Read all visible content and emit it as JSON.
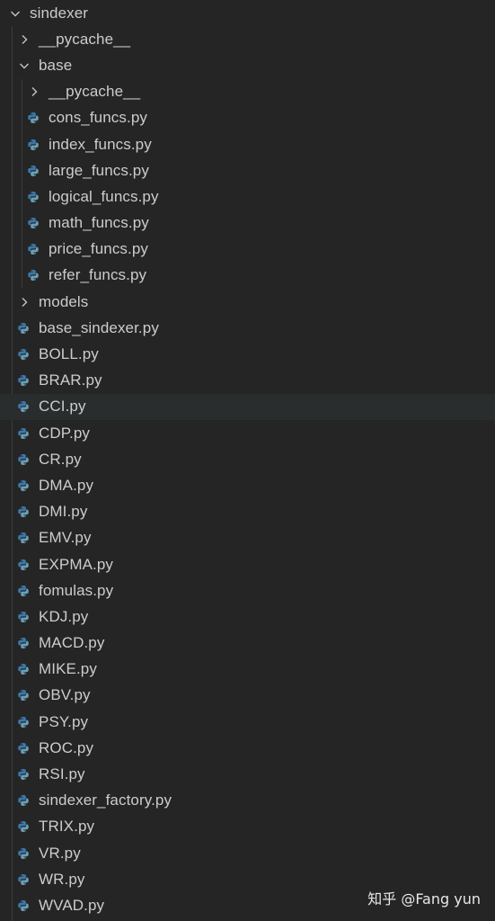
{
  "explorer": {
    "root": {
      "label": "sindexer",
      "expanded": true
    },
    "items": [
      {
        "label": "__pycache__",
        "type": "folder",
        "expanded": false,
        "depth": 1
      },
      {
        "label": "base",
        "type": "folder",
        "expanded": true,
        "depth": 1
      },
      {
        "label": "__pycache__",
        "type": "folder",
        "expanded": false,
        "depth": 2
      },
      {
        "label": "cons_funcs.py",
        "type": "python",
        "depth": 2
      },
      {
        "label": "index_funcs.py",
        "type": "python",
        "depth": 2
      },
      {
        "label": "large_funcs.py",
        "type": "python",
        "depth": 2
      },
      {
        "label": "logical_funcs.py",
        "type": "python",
        "depth": 2
      },
      {
        "label": "math_funcs.py",
        "type": "python",
        "depth": 2
      },
      {
        "label": "price_funcs.py",
        "type": "python",
        "depth": 2
      },
      {
        "label": "refer_funcs.py",
        "type": "python",
        "depth": 2
      },
      {
        "label": "models",
        "type": "folder",
        "expanded": false,
        "depth": 1
      },
      {
        "label": "base_sindexer.py",
        "type": "python",
        "depth": 1
      },
      {
        "label": "BOLL.py",
        "type": "python",
        "depth": 1
      },
      {
        "label": "BRAR.py",
        "type": "python",
        "depth": 1
      },
      {
        "label": "CCI.py",
        "type": "python",
        "depth": 1,
        "selected": true
      },
      {
        "label": "CDP.py",
        "type": "python",
        "depth": 1
      },
      {
        "label": "CR.py",
        "type": "python",
        "depth": 1
      },
      {
        "label": "DMA.py",
        "type": "python",
        "depth": 1
      },
      {
        "label": "DMI.py",
        "type": "python",
        "depth": 1
      },
      {
        "label": "EMV.py",
        "type": "python",
        "depth": 1
      },
      {
        "label": "EXPMA.py",
        "type": "python",
        "depth": 1
      },
      {
        "label": "fomulas.py",
        "type": "python",
        "depth": 1
      },
      {
        "label": "KDJ.py",
        "type": "python",
        "depth": 1
      },
      {
        "label": "MACD.py",
        "type": "python",
        "depth": 1
      },
      {
        "label": "MIKE.py",
        "type": "python",
        "depth": 1
      },
      {
        "label": "OBV.py",
        "type": "python",
        "depth": 1
      },
      {
        "label": "PSY.py",
        "type": "python",
        "depth": 1
      },
      {
        "label": "ROC.py",
        "type": "python",
        "depth": 1
      },
      {
        "label": "RSI.py",
        "type": "python",
        "depth": 1
      },
      {
        "label": "sindexer_factory.py",
        "type": "python",
        "depth": 1
      },
      {
        "label": "TRIX.py",
        "type": "python",
        "depth": 1
      },
      {
        "label": "VR.py",
        "type": "python",
        "depth": 1
      },
      {
        "label": "WR.py",
        "type": "python",
        "depth": 1
      },
      {
        "label": "WVAD.py",
        "type": "python",
        "depth": 1
      }
    ]
  },
  "watermark": "知乎 @Fang yun",
  "colors": {
    "background": "#252526",
    "text": "#cccccc",
    "selected_row": "#2a2d2e",
    "python_blue": "#3c78aa",
    "python_yellow": "#6a9fb5"
  },
  "icons": {
    "chevron_right": "chevron-right-icon",
    "chevron_down": "chevron-down-icon",
    "python": "python-file-icon"
  }
}
